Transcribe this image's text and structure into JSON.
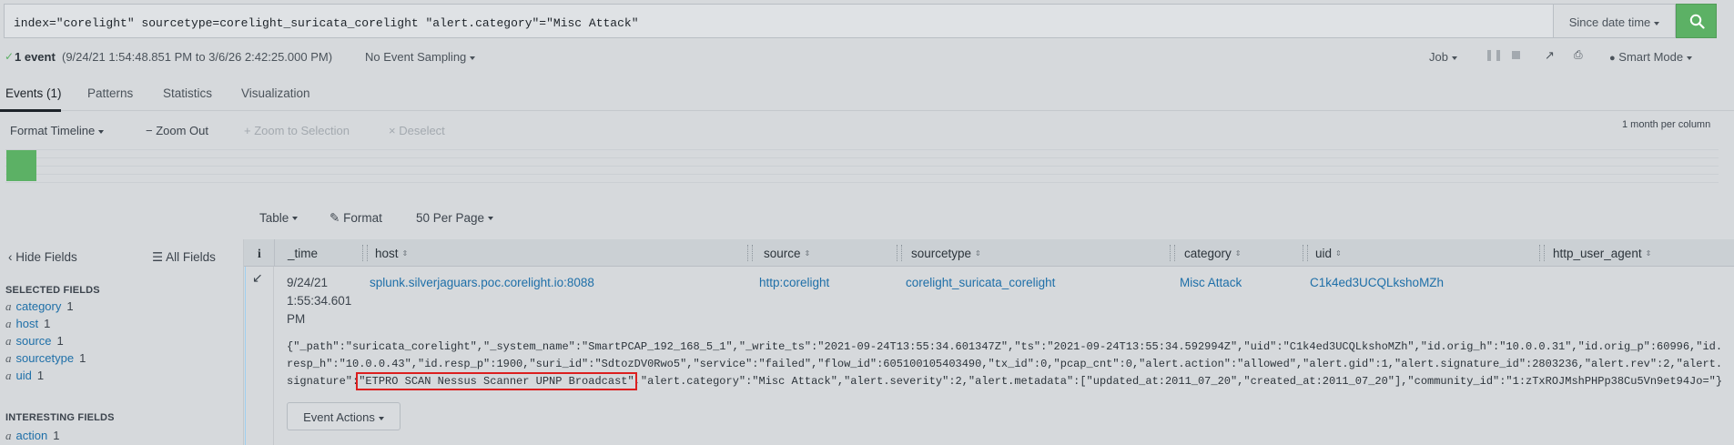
{
  "search": {
    "query": "index=\"corelight\" sourcetype=corelight_suricata_corelight \"alert.category\"=\"Misc Attack\"",
    "time_range": "Since date time",
    "search_icon": "search-icon"
  },
  "status": {
    "event_count": "1 event",
    "time_span": "(9/24/21 1:54:48.851 PM to 3/6/26 2:42:25.000 PM)",
    "sampling": "No Event Sampling",
    "job": "Job",
    "mode": "Smart Mode"
  },
  "tabs": [
    {
      "label": "Events (1)"
    },
    {
      "label": "Patterns"
    },
    {
      "label": "Statistics"
    },
    {
      "label": "Visualization"
    }
  ],
  "timeline": {
    "format": "Format Timeline",
    "zoom_out": "Zoom Out",
    "zoom_selection": "Zoom to Selection",
    "deselect": "Deselect",
    "scale": "1 month per column"
  },
  "results_toolbar": {
    "view": "Table",
    "format": "Format",
    "per_page": "50 Per Page"
  },
  "sidebar": {
    "hide_fields": "Hide Fields",
    "all_fields": "All Fields",
    "selected_heading": "SELECTED FIELDS",
    "selected_fields": [
      {
        "type": "a",
        "name": "category",
        "count": "1"
      },
      {
        "type": "a",
        "name": "host",
        "count": "1"
      },
      {
        "type": "a",
        "name": "source",
        "count": "1"
      },
      {
        "type": "a",
        "name": "sourcetype",
        "count": "1"
      },
      {
        "type": "a",
        "name": "uid",
        "count": "1"
      }
    ],
    "interesting_heading": "INTERESTING FIELDS",
    "interesting_fields": [
      {
        "type": "a",
        "name": "action",
        "count": "1"
      }
    ]
  },
  "table": {
    "info_header": "i",
    "columns": [
      "_time",
      "host",
      "source",
      "sourcetype",
      "category",
      "uid",
      "http_user_agent"
    ],
    "row": {
      "time_line1": "9/24/21",
      "time_line2": "1:55:34.601",
      "time_line3": "PM",
      "host": "splunk.silverjaguars.poc.corelight.io:8088",
      "source": "http:corelight",
      "sourcetype": "corelight_suricata_corelight",
      "category": "Misc Attack",
      "uid": "C1k4ed3UCQLkshoMZh"
    },
    "raw_before": "{\"_path\":\"suricata_corelight\",\"_system_name\":\"SmartPCAP_192_168_5_1\",\"_write_ts\":\"2021-09-24T13:55:34.601347Z\",\"ts\":\"2021-09-24T13:55:34.592994Z\",\"uid\":\"C1k4ed3UCQLkshoMZh\",\"id.orig_h\":\"10.0.0.31\",\"id.orig_p\":60996,\"id.resp_h\":\"10.0.0.43\",\"id.resp_p\":1900,\"suri_id\":\"SdtozDV0Rwo5\",\"service\":\"failed\",\"flow_id\":605100105403490,\"tx_id\":0,\"pcap_cnt\":0,\"alert.action\":\"allowed\",\"alert.gid\":1,\"alert.signature_id\":2803236,\"alert.rev\":2,\"alert.signature\":",
    "raw_highlight": "\"ETPRO SCAN Nessus Scanner UPNP Broadcast\"",
    "raw_after": ",\"alert.category\":\"Misc Attack\",\"alert.severity\":2,\"alert.metadata\":[\"updated_at:2011_07_20\",\"created_at:2011_07_20\"],\"community_id\":\"1:zTxROJMshPHPp38Cu5Vn9et94Jo=\"}",
    "event_actions": "Event Actions"
  },
  "colors": {
    "accent_green": "#5cb165",
    "link_blue": "#1e6fa8",
    "highlight_red": "#dc1f1f"
  }
}
